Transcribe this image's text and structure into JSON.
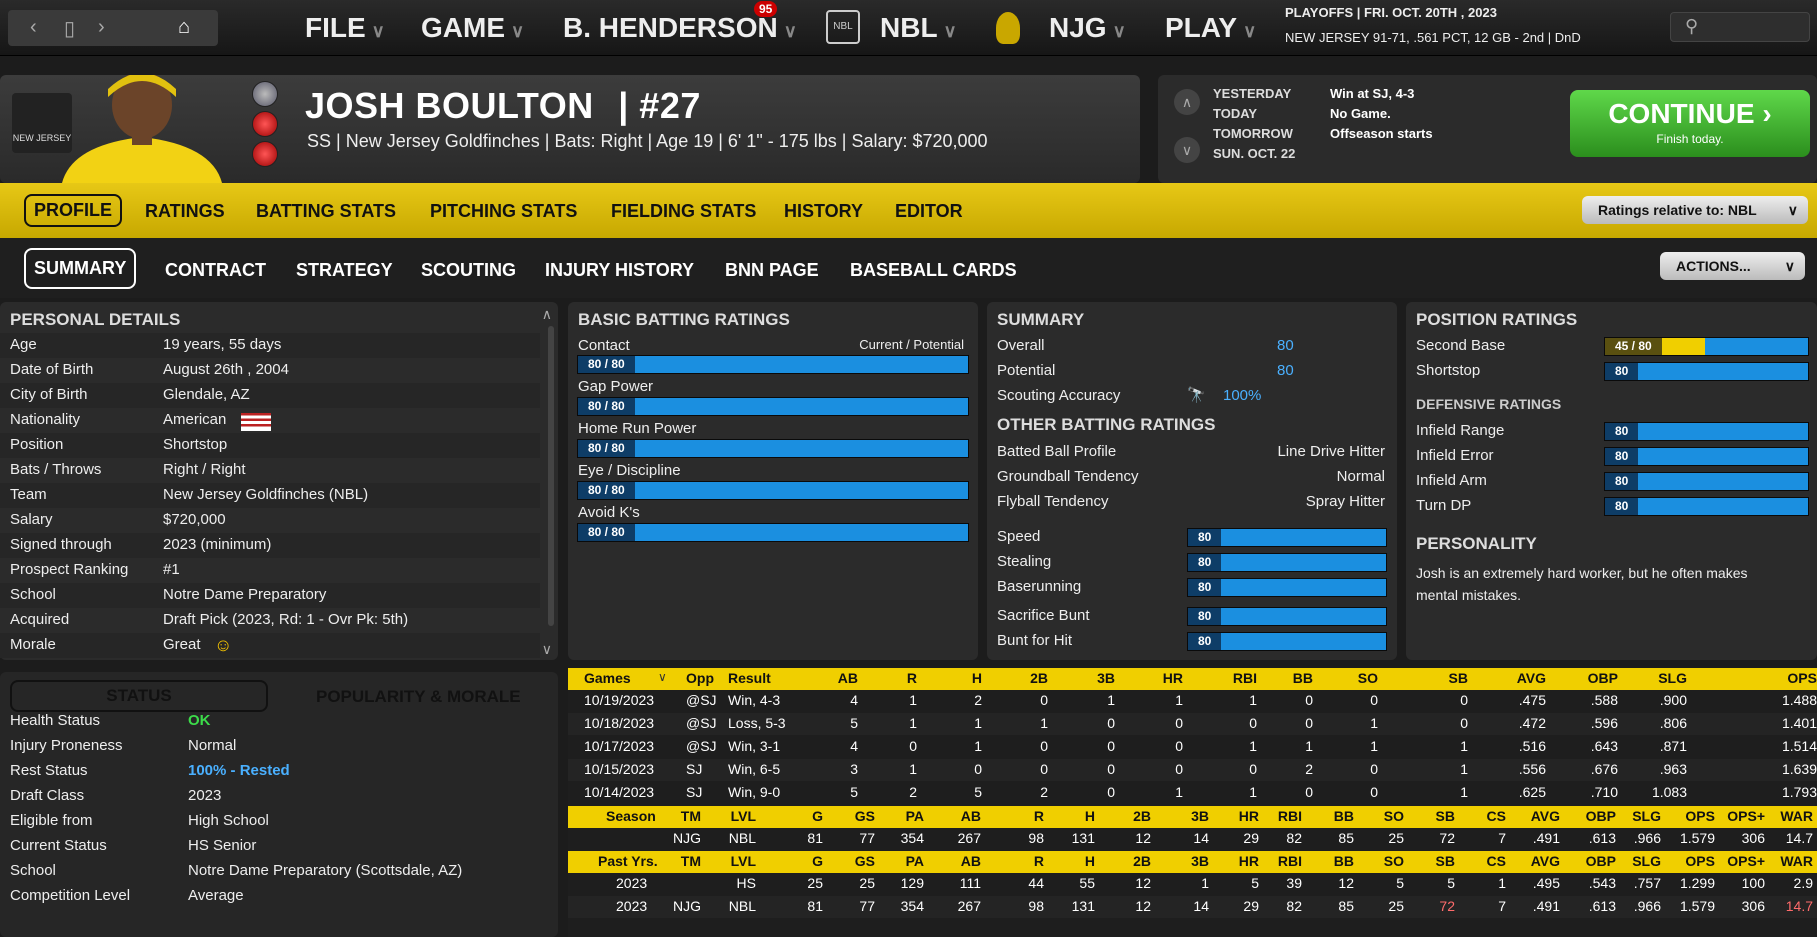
{
  "topbar": {
    "menus": [
      "FILE",
      "GAME",
      "B. HENDERSON",
      "NBL",
      "NJG",
      "PLAY"
    ],
    "badge": "95",
    "status1": "PLAYOFFS | FRI. OCT. 20TH , 2023",
    "status2": "NEW JERSEY  91-71, .561 PCT, 12 GB - 2nd | DnD"
  },
  "player": {
    "name": "JOSH BOULTON",
    "number": "| #27",
    "subline": "SS | New Jersey Goldfinches  |  Bats: Right  |  Age 19  |  6' 1\" - 175 lbs  |  Salary: $720,000",
    "team_logo_text": "NEW JERSEY"
  },
  "schedule": {
    "rows": [
      {
        "label": "YESTERDAY",
        "value": "Win at SJ, 4-3"
      },
      {
        "label": "TODAY",
        "value": "No Game."
      },
      {
        "label": "TOMORROW",
        "value": "Offseason starts"
      },
      {
        "label": "SUN. OCT. 22",
        "value": ""
      }
    ],
    "continue": "CONTINUE",
    "continue_sub": "Finish today."
  },
  "tabs1": [
    "PROFILE",
    "RATINGS",
    "BATTING STATS",
    "PITCHING STATS",
    "FIELDING STATS",
    "HISTORY",
    "EDITOR"
  ],
  "ratings_relative": "Ratings relative to: NBL",
  "tabs2": [
    "SUMMARY",
    "CONTRACT",
    "STRATEGY",
    "SCOUTING",
    "INJURY HISTORY",
    "BNN PAGE",
    "BASEBALL CARDS"
  ],
  "actions": "ACTIONS...",
  "personal": {
    "title": "PERSONAL DETAILS",
    "rows": [
      [
        "Age",
        "19 years, 55 days"
      ],
      [
        "Date of Birth",
        "August 26th , 2004"
      ],
      [
        "City of Birth",
        "Glendale, AZ"
      ],
      [
        "Nationality",
        "American"
      ],
      [
        "Position",
        "Shortstop"
      ],
      [
        "Bats / Throws",
        "Right / Right"
      ],
      [
        "Team",
        "New Jersey Goldfinches (NBL)"
      ],
      [
        "Salary",
        "$720,000"
      ],
      [
        "Signed through",
        "2023 (minimum)"
      ],
      [
        "Prospect Ranking",
        "#1"
      ],
      [
        "School",
        "Notre Dame Preparatory"
      ],
      [
        "Acquired",
        "Draft Pick (2023, Rd: 1 - Ovr Pk: 5th)"
      ],
      [
        "Morale",
        "Great"
      ]
    ]
  },
  "basic_batting": {
    "title": "BASIC BATTING RATINGS",
    "header_right": "Current / Potential",
    "rows": [
      {
        "label": "Contact",
        "value": "80 / 80"
      },
      {
        "label": "Gap Power",
        "value": "80 / 80"
      },
      {
        "label": "Home Run Power",
        "value": "80 / 80"
      },
      {
        "label": "Eye / Discipline",
        "value": "80 / 80"
      },
      {
        "label": "Avoid K's",
        "value": "80 / 80"
      }
    ]
  },
  "summary": {
    "title": "SUMMARY",
    "overall_label": "Overall",
    "overall": "80",
    "potential_label": "Potential",
    "potential": "80",
    "scouting_label": "Scouting Accuracy",
    "scouting": "100%",
    "other_title": "OTHER BATTING RATINGS",
    "other": [
      [
        "Batted Ball Profile",
        "Line Drive Hitter"
      ],
      [
        "Groundball Tendency",
        "Normal"
      ],
      [
        "Flyball Tendency",
        "Spray Hitter"
      ]
    ],
    "bars": [
      [
        "Speed",
        "80"
      ],
      [
        "Stealing",
        "80"
      ],
      [
        "Baserunning",
        "80"
      ],
      [
        "Sacrifice Bunt",
        "80"
      ],
      [
        "Bunt for Hit",
        "80"
      ]
    ]
  },
  "position": {
    "title": "POSITION RATINGS",
    "rows": [
      [
        "Second Base",
        "45 / 80"
      ],
      [
        "Shortstop",
        "80"
      ]
    ],
    "def_title": "DEFENSIVE RATINGS",
    "def": [
      [
        "Infield Range",
        "80"
      ],
      [
        "Infield Error",
        "80"
      ],
      [
        "Infield Arm",
        "80"
      ],
      [
        "Turn DP",
        "80"
      ]
    ],
    "personality_title": "PERSONALITY",
    "personality": "Josh is an extremely hard worker, but he often makes mental mistakes."
  },
  "status_tabs": [
    "STATUS",
    "POPULARITY & MORALE"
  ],
  "status": [
    [
      "Health Status",
      "OK"
    ],
    [
      "Injury Proneness",
      "Normal"
    ],
    [
      "Rest Status",
      "100% - Rested"
    ],
    [
      "Draft Class",
      "2023"
    ],
    [
      "Eligible from",
      "High School"
    ],
    [
      "Current Status",
      "HS Senior"
    ],
    [
      "School",
      "Notre Dame Preparatory (Scottsdale, AZ)"
    ],
    [
      "Competition Level",
      "Average"
    ]
  ],
  "games": {
    "headers": [
      "Games",
      "Opp",
      "Result",
      "AB",
      "R",
      "H",
      "2B",
      "3B",
      "HR",
      "RBI",
      "BB",
      "SO",
      "SB",
      "AVG",
      "OBP",
      "SLG",
      "OPS"
    ],
    "rows": [
      [
        "10/19/2023",
        "@SJ",
        "Win, 4-3",
        "4",
        "1",
        "2",
        "0",
        "1",
        "1",
        "1",
        "0",
        "0",
        "0",
        ".475",
        ".588",
        ".900",
        "1.488"
      ],
      [
        "10/18/2023",
        "@SJ",
        "Loss, 5-3",
        "5",
        "1",
        "1",
        "1",
        "0",
        "0",
        "0",
        "0",
        "1",
        "0",
        ".472",
        ".596",
        ".806",
        "1.401"
      ],
      [
        "10/17/2023",
        "@SJ",
        "Win, 3-1",
        "4",
        "0",
        "1",
        "0",
        "0",
        "0",
        "1",
        "1",
        "1",
        "1",
        ".516",
        ".643",
        ".871",
        "1.514"
      ],
      [
        "10/15/2023",
        "SJ",
        "Win, 6-5",
        "3",
        "1",
        "0",
        "0",
        "0",
        "0",
        "0",
        "2",
        "0",
        "1",
        ".556",
        ".676",
        ".963",
        "1.639"
      ],
      [
        "10/14/2023",
        "SJ",
        "Win, 9-0",
        "5",
        "2",
        "5",
        "2",
        "0",
        "1",
        "1",
        "0",
        "0",
        "1",
        ".625",
        ".710",
        "1.083",
        "1.793"
      ]
    ]
  },
  "season": {
    "headers": [
      "Season",
      "TM",
      "LVL",
      "G",
      "GS",
      "PA",
      "AB",
      "R",
      "H",
      "2B",
      "3B",
      "HR",
      "RBI",
      "BB",
      "SO",
      "SB",
      "CS",
      "AVG",
      "OBP",
      "SLG",
      "OPS",
      "OPS+",
      "WAR"
    ],
    "rows": [
      [
        "",
        "NJG",
        "NBL",
        "81",
        "77",
        "354",
        "267",
        "98",
        "131",
        "12",
        "14",
        "29",
        "82",
        "85",
        "25",
        "72",
        "7",
        ".491",
        ".613",
        ".966",
        "1.579",
        "306",
        "14.7"
      ]
    ]
  },
  "past": {
    "headers": [
      "Past Yrs.",
      "TM",
      "LVL",
      "G",
      "GS",
      "PA",
      "AB",
      "R",
      "H",
      "2B",
      "3B",
      "HR",
      "RBI",
      "BB",
      "SO",
      "SB",
      "CS",
      "AVG",
      "OBP",
      "SLG",
      "OPS",
      "OPS+",
      "WAR"
    ],
    "rows": [
      [
        "2023",
        "",
        "HS",
        "25",
        "25",
        "129",
        "111",
        "44",
        "55",
        "12",
        "1",
        "5",
        "39",
        "12",
        "5",
        "5",
        "1",
        ".495",
        ".543",
        ".757",
        "1.299",
        "100",
        "2.9"
      ],
      [
        "2023",
        "NJG",
        "NBL",
        "81",
        "77",
        "354",
        "267",
        "98",
        "131",
        "12",
        "14",
        "29",
        "82",
        "85",
        "25",
        "72",
        "7",
        ".491",
        ".613",
        ".966",
        "1.579",
        "306",
        "14.7"
      ]
    ]
  }
}
